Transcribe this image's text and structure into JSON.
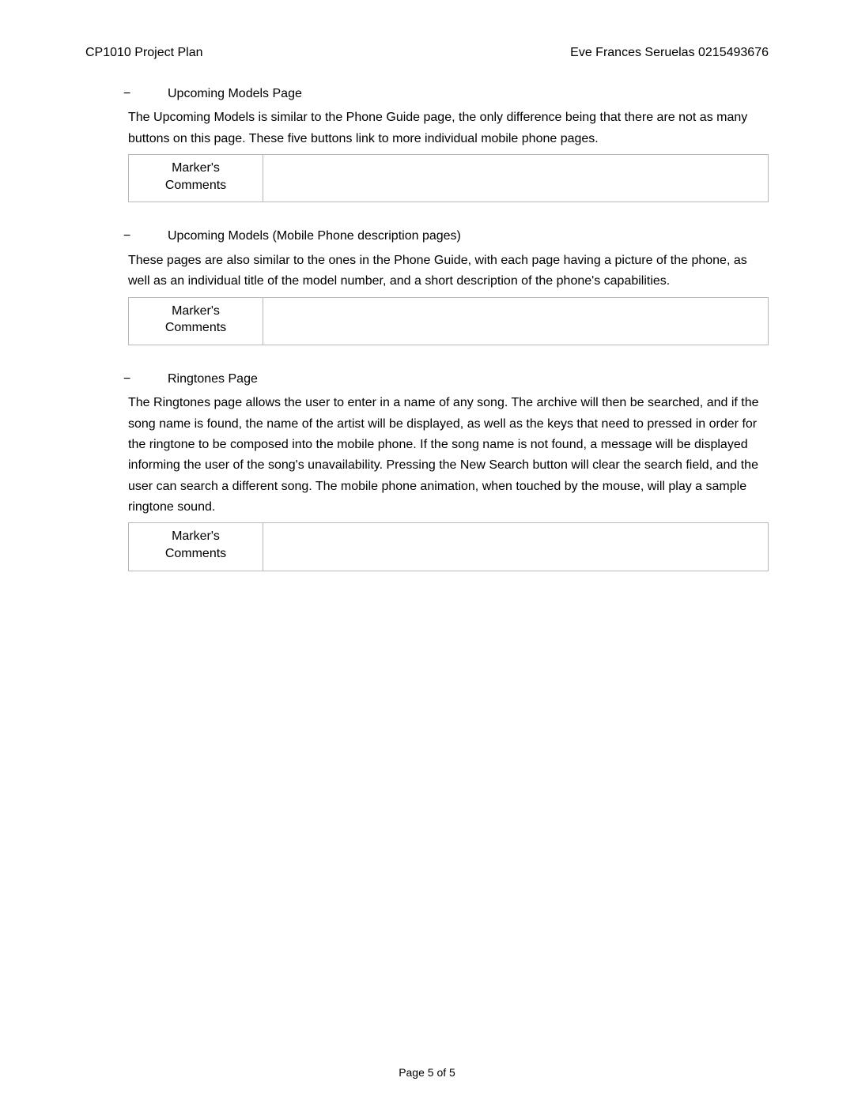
{
  "header": {
    "left": "CP1010 Project Plan",
    "right": "Eve Frances Seruelas   0215493676"
  },
  "sections": [
    {
      "bullet_dash": "−",
      "title": "Upcoming Models Page",
      "body": "The Upcoming Models is similar to the Phone Guide page, the only difference being that there are not as many buttons on this page. These five buttons link to more individual mobile phone pages.",
      "box_label_line1": "Marker's",
      "box_label_line2": "Comments",
      "box_value": ""
    },
    {
      "bullet_dash": "−",
      "title": "Upcoming Models (Mobile Phone description pages)",
      "body": "These pages are also similar to the ones in the Phone Guide, with each page having a picture of the phone, as well as an individual title of the model number, and a short description of the phone's capabilities.",
      "box_label_line1": "Marker's",
      "box_label_line2": "Comments",
      "box_value": ""
    },
    {
      "bullet_dash": "−",
      "title": "Ringtones Page",
      "body": "The Ringtones page allows the user to enter in a name of any song. The archive will then be searched, and if the song name is found, the name of the artist will be displayed, as well as the keys that need to pressed in order for the ringtone to be composed into the mobile phone. If the song name is not found, a message will be displayed informing the user of the song's unavailability. Pressing the New Search button will clear the search field, and the user can search a different song. The mobile phone animation, when touched by the mouse, will play a sample ringtone sound.",
      "box_label_line1": "Marker's",
      "box_label_line2": "Comments",
      "box_value": ""
    }
  ],
  "footer": "Page 5 of 5"
}
